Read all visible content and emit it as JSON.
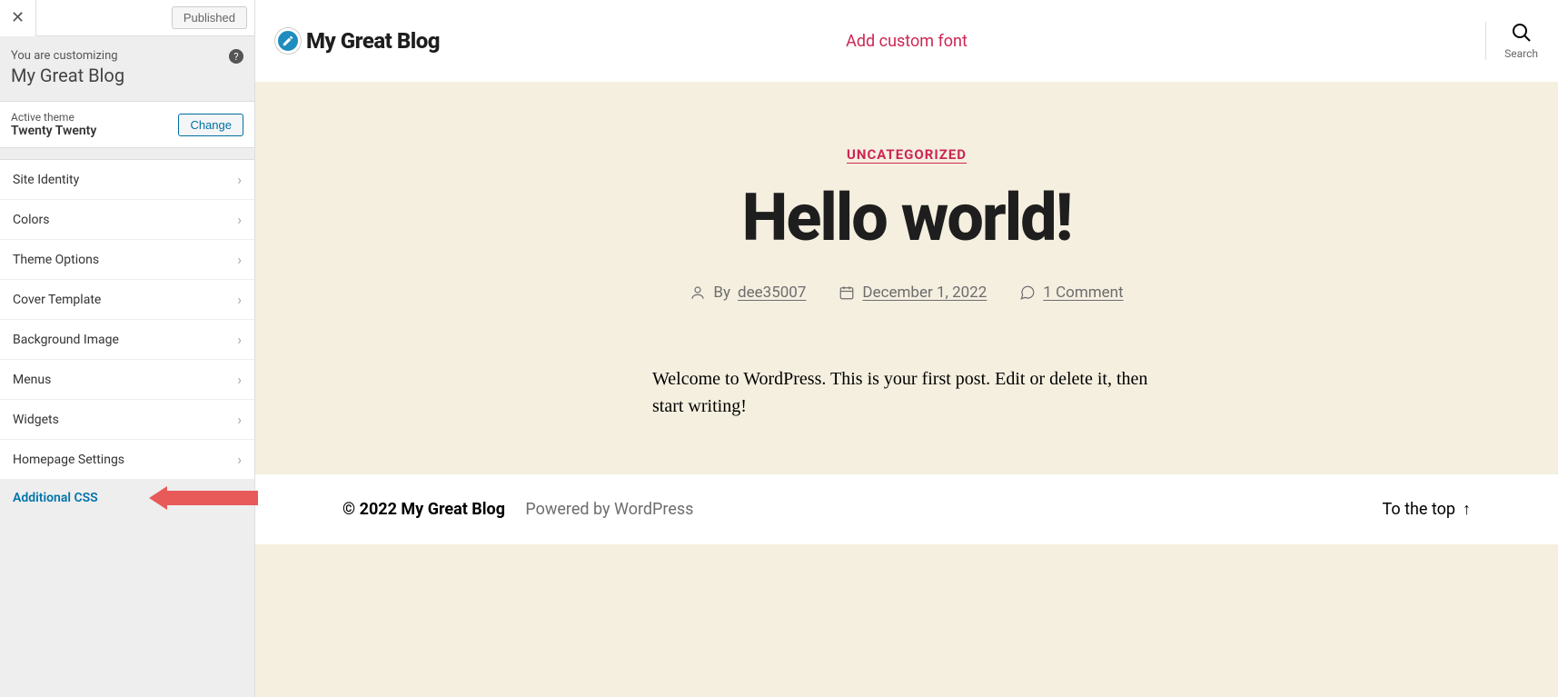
{
  "sidebar": {
    "published_label": "Published",
    "customizing_label": "You are customizing",
    "site_name": "My Great Blog",
    "active_theme_label": "Active theme",
    "active_theme_name": "Twenty Twenty",
    "change_label": "Change",
    "menu": [
      {
        "label": "Site Identity"
      },
      {
        "label": "Colors"
      },
      {
        "label": "Theme Options"
      },
      {
        "label": "Cover Template"
      },
      {
        "label": "Background Image"
      },
      {
        "label": "Menus"
      },
      {
        "label": "Widgets"
      },
      {
        "label": "Homepage Settings"
      },
      {
        "label": "Additional CSS",
        "active": true,
        "callout": true
      }
    ]
  },
  "preview": {
    "site_title": "My Great Blog",
    "nav_link": "Add custom font",
    "search_label": "Search",
    "post": {
      "category": "UNCATEGORIZED",
      "title": "Hello world!",
      "by_label": "By",
      "author": "dee35007",
      "date": "December 1, 2022",
      "comments": "1 Comment",
      "content": "Welcome to WordPress. This is your first post. Edit or delete it, then start writing!"
    },
    "footer": {
      "copyright": "© 2022 My Great Blog",
      "powered": "Powered by WordPress",
      "to_top": "To the top"
    }
  }
}
